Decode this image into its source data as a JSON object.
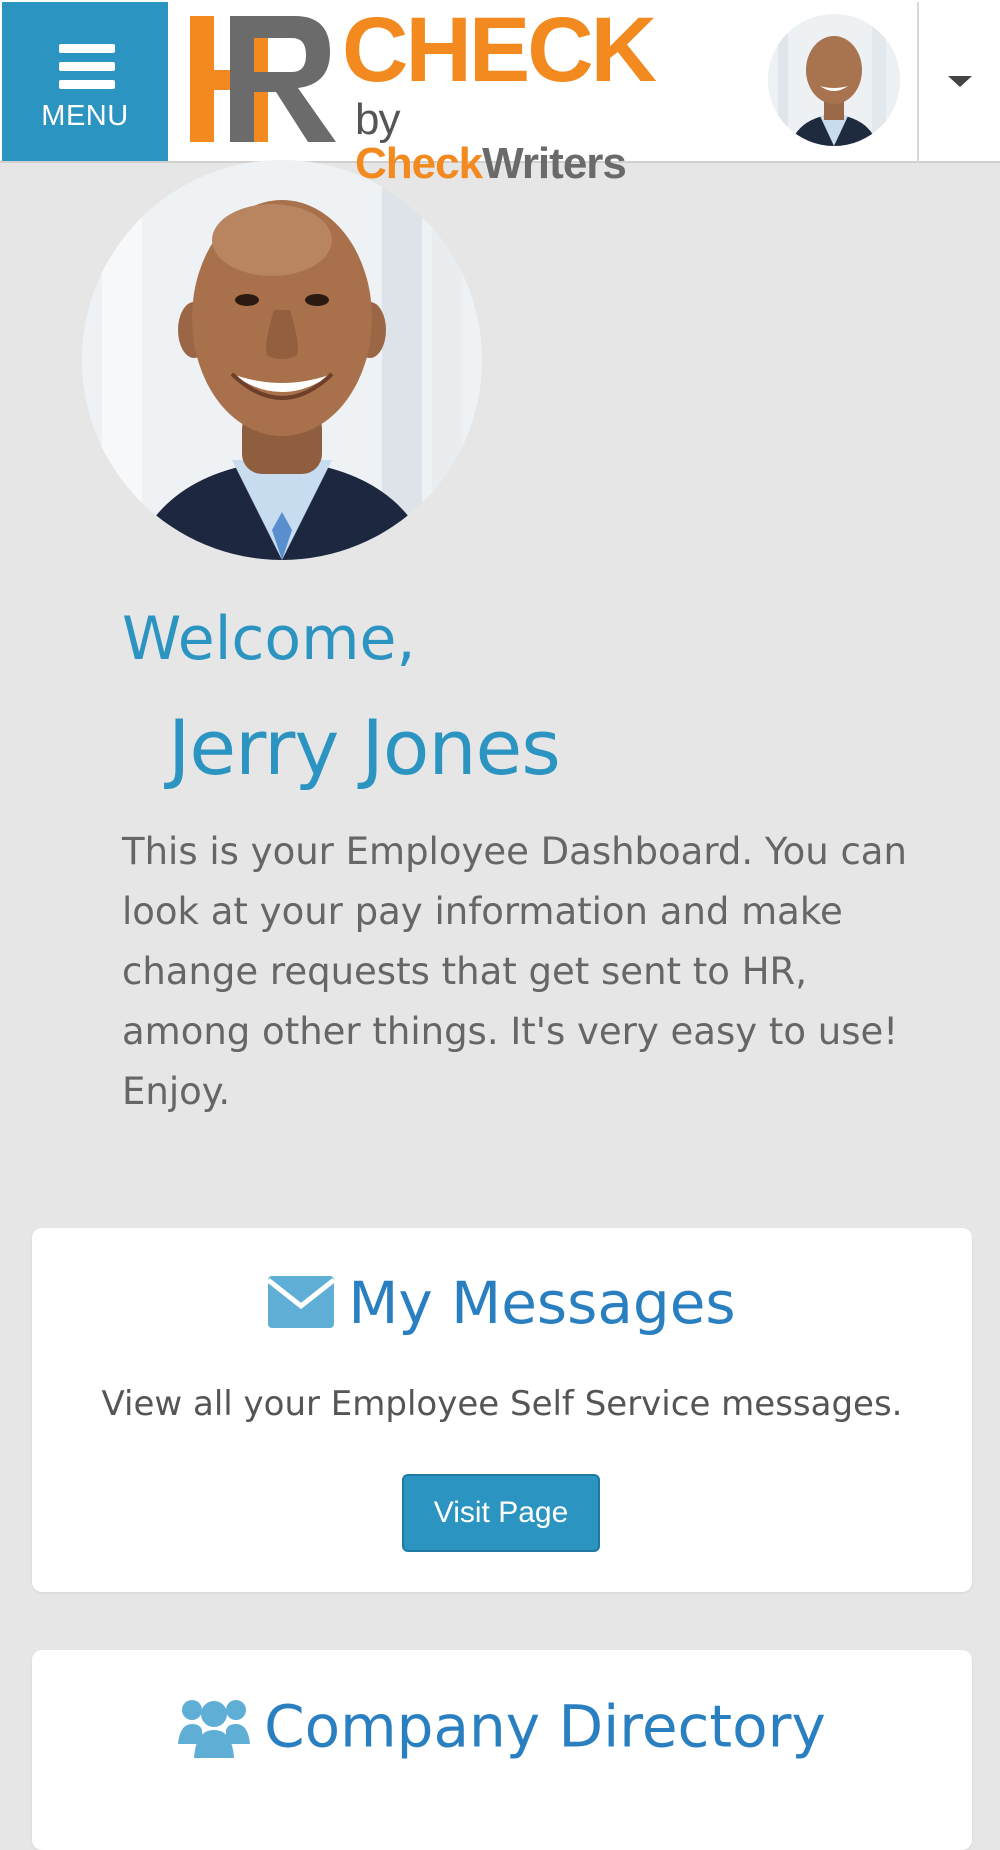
{
  "header": {
    "menu_label": "MENU",
    "logo": {
      "hr": "HR",
      "check": "CHECK",
      "by": "by",
      "brand_check": "Check",
      "brand_writers": "Writers"
    }
  },
  "profile": {
    "welcome": "Welcome,",
    "name": "Jerry Jones",
    "intro": "This is your Employee Dashboard. You can look at your pay information and make change requests that get sent to HR, among other things. It's very easy to use! Enjoy."
  },
  "cards": {
    "messages": {
      "icon": "envelope-icon",
      "title": "My Messages",
      "description": "View all your Employee Self Service messages.",
      "button": "Visit Page"
    },
    "directory": {
      "icon": "users-icon",
      "title": "Company Directory"
    }
  },
  "colors": {
    "accent": "#2b94c0",
    "brand_orange": "#f28a20",
    "title_blue": "#2a7fc0",
    "background": "#e6e6e6"
  }
}
